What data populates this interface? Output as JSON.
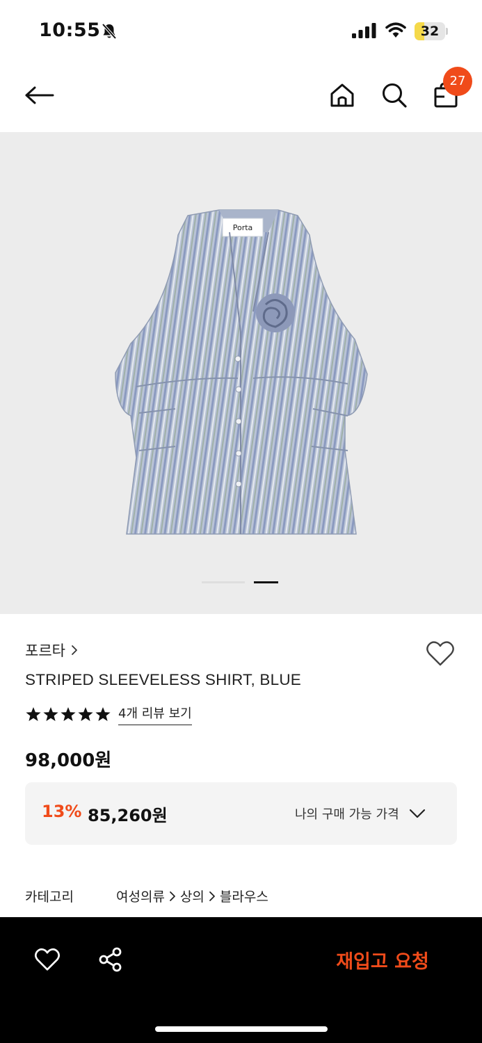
{
  "status_bar": {
    "time": "10:55",
    "battery_level": "32",
    "battery_fraction": 0.32,
    "battery_color": "#f5d94a",
    "icons": [
      "bell-off-icon",
      "signal-icon",
      "wifi-icon",
      "battery-icon"
    ]
  },
  "header": {
    "cart_count": "27",
    "icons": [
      "back-arrow-icon",
      "home-icon",
      "search-icon",
      "shopping-bag-icon"
    ],
    "badge_color": "#f04b1a"
  },
  "gallery": {
    "image_description_icon": "product-image",
    "label_text": "Porta",
    "page_count": 2,
    "active_page": 2
  },
  "product": {
    "brand": "포르타",
    "name": "STRIPED SLEEVELESS SHIRT, BLUE",
    "rating_stars": 5,
    "review_link": "4개 리뷰 보기",
    "price": "98,000원",
    "discount_rate": "13%",
    "discount_price": "85,260원",
    "my_price_label": "나의 구매 가능 가격"
  },
  "category": {
    "title": "카테고리",
    "path": [
      "여성의류",
      "상의",
      "블라우스"
    ]
  },
  "bottom_bar": {
    "restock_label": "재입고 요청",
    "accent_color": "#f04b1a"
  }
}
